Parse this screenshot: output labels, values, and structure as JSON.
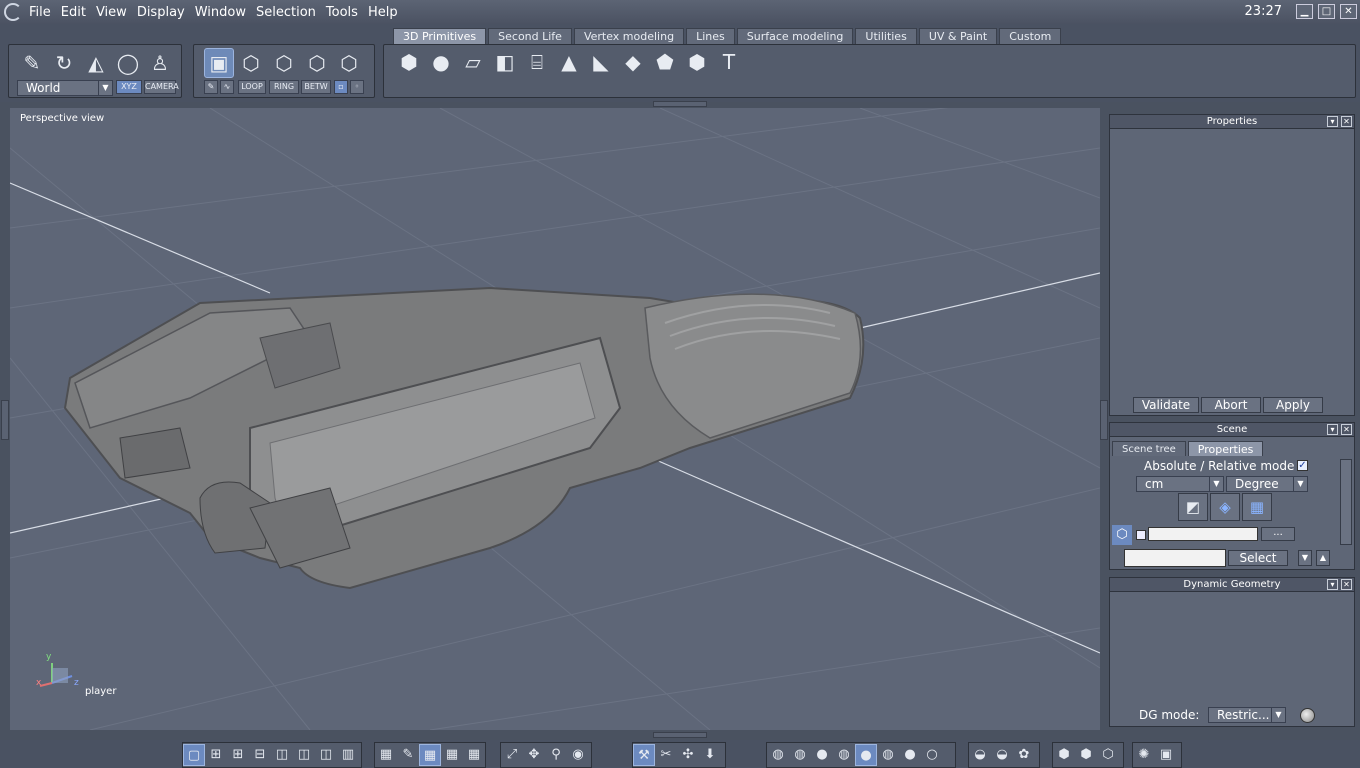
{
  "menu": [
    "File",
    "Edit",
    "View",
    "Display",
    "Window",
    "Selection",
    "Tools",
    "Help"
  ],
  "clock": "23:27",
  "window_controls": {
    "minimize": "▁",
    "maximize": "□",
    "close": "✕"
  },
  "toolbar": {
    "coord_system": "World",
    "xyz_label": "XYZ",
    "camera_label": "CAMERA",
    "select_modes": {
      "loop": "LOOP",
      "ring": "RING",
      "betw": "BETW"
    },
    "tabs": [
      "3D Primitives",
      "Second Life",
      "Vertex modeling",
      "Lines",
      "Surface modeling",
      "Utilities",
      "UV & Paint",
      "Custom"
    ],
    "active_tab": "3D Primitives"
  },
  "viewport": {
    "label": "Perspective view",
    "axis_caption": "player",
    "axis_labels": {
      "x": "x",
      "y": "y",
      "z": "z"
    }
  },
  "properties_panel": {
    "title": "Properties",
    "buttons": {
      "validate": "Validate",
      "abort": "Abort",
      "apply": "Apply"
    }
  },
  "scene_panel": {
    "title": "Scene",
    "tabs": [
      "Scene tree",
      "Properties"
    ],
    "active_tab": "Properties",
    "mode_label": "Absolute / Relative mode",
    "unit": "cm",
    "angle_unit": "Degree",
    "browse_label": "...",
    "select_button": "Select"
  },
  "dynamic_geometry_panel": {
    "title": "Dynamic Geometry",
    "mode_label": "DG mode:",
    "mode_value": "Restric..."
  },
  "colors": {
    "accent": "#6c8ac0",
    "background": "#4a5260",
    "viewport": "#5e6677"
  }
}
